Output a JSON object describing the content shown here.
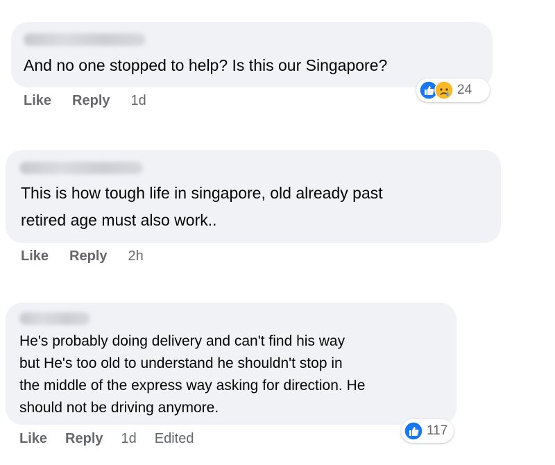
{
  "comments": [
    {
      "text": "And no one stopped to help? Is this our Singapore?",
      "actions": {
        "like": "Like",
        "reply": "Reply",
        "time": "1d"
      },
      "reactions": {
        "icons": [
          "like-reaction-icon",
          "sad-reaction-icon"
        ],
        "count": "24"
      }
    },
    {
      "text_lines": [
        "This is how tough life in singapore, old already past",
        "retired age must also work.."
      ],
      "actions": {
        "like": "Like",
        "reply": "Reply",
        "time": "2h"
      }
    },
    {
      "text_lines": [
        "He's probably doing delivery and can't find his way",
        "but He's too old to understand he shouldn't stop in",
        "the middle of the express way asking for direction. He",
        "should not be driving anymore."
      ],
      "actions": {
        "like": "Like",
        "reply": "Reply",
        "time": "1d",
        "edited": "Edited"
      },
      "reactions": {
        "icons": [
          "like-reaction-icon"
        ],
        "count": "117"
      }
    }
  ],
  "colors": {
    "bubble": "#f0f2f5",
    "text": "#050505",
    "secondary": "#65676b",
    "like_blue": "#1877f2",
    "sad_yellow": "#f7b928"
  }
}
